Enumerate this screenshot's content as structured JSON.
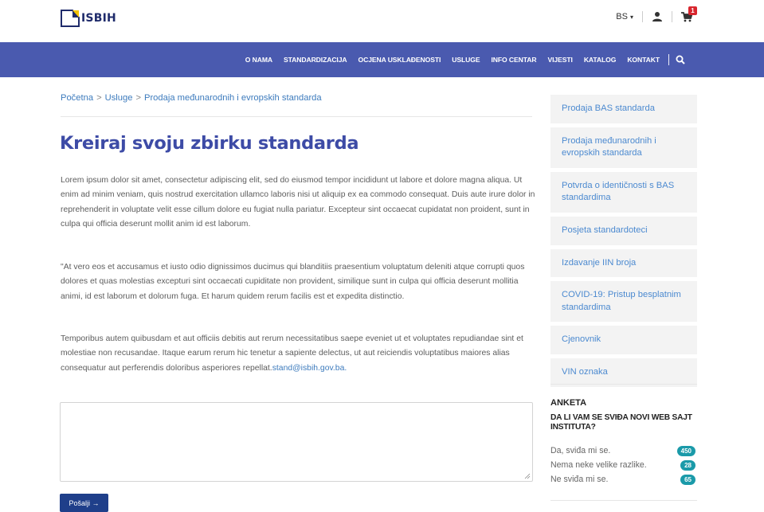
{
  "brand": {
    "logo_text": "ISBIH",
    "accent": "#4a5aaf",
    "logo_yellow": "#f2c200",
    "logo_navy": "#1f2b6b"
  },
  "header": {
    "language": "BS",
    "cart_count": "1"
  },
  "nav": {
    "items": [
      "O NAMA",
      "STANDARDIZACIJA",
      "OCJENA USKLAĐENOSTI",
      "USLUGE",
      "INFO CENTAR",
      "VIJESTI",
      "KATALOG",
      "KONTAKT"
    ],
    "search_icon": "search-icon"
  },
  "breadcrumb": [
    "Početna",
    "Usluge",
    "Prodaja međunarodnih i evropskih standarda"
  ],
  "breadcrumb_sep": ">",
  "main": {
    "title": "Kreiraj svoju zbirku standarda",
    "paragraphs": [
      "Lorem ipsum dolor sit amet, consectetur adipiscing elit, sed do eiusmod tempor incididunt ut labore et dolore magna aliqua. Ut enim ad minim veniam, quis nostrud exercitation ullamco laboris nisi ut aliquip ex ea commodo consequat. Duis aute irure dolor in reprehenderit in voluptate velit esse cillum dolore eu fugiat nulla pariatur. Excepteur sint occaecat cupidatat non proident, sunt in culpa qui officia deserunt mollit anim id est laborum.",
      "\"At vero eos et accusamus et iusto odio dignissimos ducimus qui blanditiis praesentium voluptatum deleniti atque corrupti quos dolores et quas molestias excepturi sint occaecati cupiditate non provident, similique sunt in culpa qui officia deserunt mollitia animi, id est laborum et dolorum fuga. Et harum quidem rerum facilis est et expedita distinctio.",
      "Temporibus autem quibusdam et aut officiis debitis aut rerum necessitatibus saepe eveniet ut et voluptates repudiandae sint et molestiae non recusandae. Itaque earum rerum hic tenetur a sapiente delectus, ut aut reiciendis voluptatibus maiores alias consequatur aut perferendis doloribus asperiores repellat."
    ],
    "email_link": "stand@isbih.gov.ba.",
    "textarea_value": "",
    "submit_label": "Pošalji →"
  },
  "sidebar": {
    "items": [
      "Prodaja BAS standarda",
      "Prodaja međunarodnih i evropskih standarda",
      "Potvrda o identičnosti s BAS standardima",
      "Posjeta standardoteci",
      "Izdavanje IIN broja",
      "COVID-19: Pristup besplatnim standardima",
      "Cjenovnik",
      "VIN oznaka"
    ]
  },
  "poll": {
    "title": "ANKETA",
    "question": "DA LI VAM SE SVIĐA NOVI WEB SAJT INSTITUTA?",
    "options": [
      {
        "label": "Da, sviđa mi se.",
        "count": "450"
      },
      {
        "label": "Nema neke velike razlike.",
        "count": "28"
      },
      {
        "label": "Ne sviđa mi se.",
        "count": "65"
      }
    ]
  }
}
